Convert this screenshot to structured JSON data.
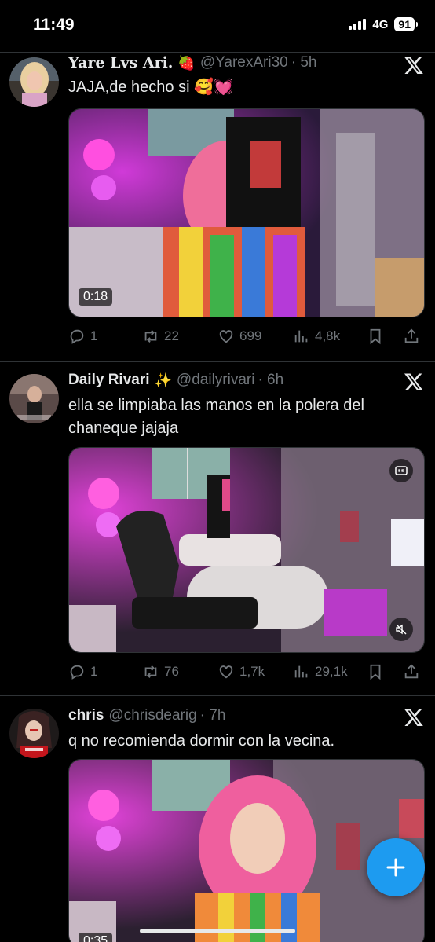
{
  "status_bar": {
    "time": "11:49",
    "network": "4G",
    "battery": "91"
  },
  "tweets": [
    {
      "name": "Yare Lvs Ari.",
      "name_emoji": "🍓",
      "handle": "@YarexAri30",
      "time": "· 5h",
      "text": "JAJA,de hecho si 🥰💓",
      "media_duration": "0:18",
      "replies": "1",
      "reposts": "22",
      "likes": "699",
      "views": "4,8k"
    },
    {
      "name": "Daily Rivari",
      "name_emoji": "✨",
      "handle": "@dailyrivari",
      "time": "· 6h",
      "text": "ella se limpiaba las manos en la polera del chaneque jajaja",
      "replies": "1",
      "reposts": "76",
      "likes": "1,7k",
      "views": "29,1k"
    },
    {
      "name": "chris",
      "handle": "@chrisdearig",
      "time": "· 7h",
      "text": "q no recomienda dormir con la vecina.",
      "media_duration": "0:35"
    }
  ],
  "icons": {
    "reply": "reply-icon",
    "repost": "repost-icon",
    "like": "heart-icon",
    "views": "views-icon",
    "bookmark": "bookmark-icon",
    "share": "share-icon",
    "compose": "plus-icon",
    "x": "x-logo-icon"
  },
  "colors": {
    "accent": "#1d9bf0",
    "text": "#e7e9ea",
    "muted": "#71767b",
    "divider": "#2f3336"
  }
}
